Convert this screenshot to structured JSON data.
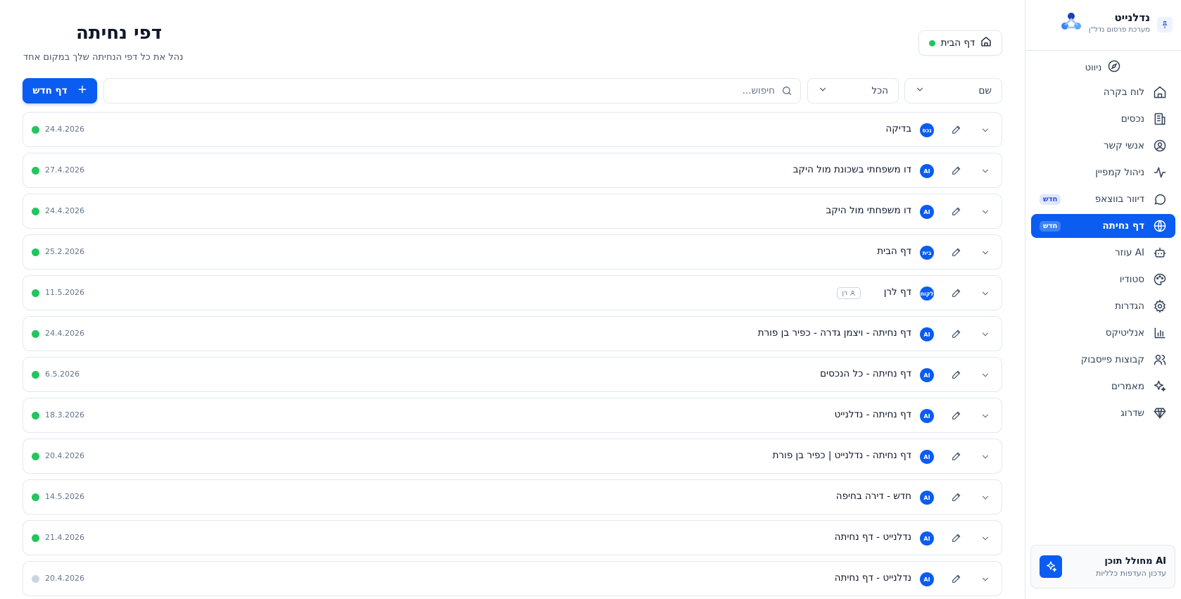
{
  "sidebar": {
    "brand_name": "נדלנייט",
    "brand_sub": "מערכת פרסום נדל\"ן",
    "nav_title": "ניווט",
    "items": [
      {
        "label": "לוח בקרה",
        "icon": "home-icon"
      },
      {
        "label": "נכסים",
        "icon": "building-icon"
      },
      {
        "label": "אנשי קשר",
        "icon": "user-circle-icon"
      },
      {
        "label": "ניהול קמפיין",
        "icon": "activity-icon"
      },
      {
        "label": "דיוור בווצאפ",
        "icon": "chat-icon",
        "badge": "חדש"
      },
      {
        "label": "דף נחיתה",
        "icon": "globe-icon",
        "badge": "חדש",
        "active": true
      },
      {
        "label": "עוזר AI",
        "icon": "bot-icon"
      },
      {
        "label": "סטודיו",
        "icon": "palette-icon"
      },
      {
        "label": "הגדרות",
        "icon": "gear-icon"
      },
      {
        "label": "אנליטיקס",
        "icon": "bar-chart-icon"
      },
      {
        "label": "קבוצות פייסבוק",
        "icon": "users-icon"
      },
      {
        "label": "מאמרים",
        "icon": "sparkles-icon"
      },
      {
        "label": "שדרוג",
        "icon": "gem-icon"
      }
    ],
    "ai_card": {
      "title": "מחולל תוכן AI",
      "subtitle": "עדכון העדפות כלליות"
    }
  },
  "header": {
    "title": "דפי נחיתה",
    "subtitle": "נהל את כל דפי הנחיתה שלך במקום אחד",
    "home_button": "דף הבית"
  },
  "toolbar": {
    "new_button": "דף חדש",
    "search_placeholder": "חיפוש...",
    "filter_value": "הכל",
    "sort_value": "שם"
  },
  "pages": [
    {
      "name": "בדיקה",
      "tag": "נכס",
      "date": "24.4.2026",
      "active": true
    },
    {
      "name": "דו משפחתי בשכונת מול היקב",
      "tag": "AI",
      "date": "27.4.2026",
      "active": true
    },
    {
      "name": "דו משפחתי מול היקב",
      "tag": "AI",
      "date": "24.4.2026",
      "active": true
    },
    {
      "name": "דף הבית",
      "tag": "בית",
      "date": "25.2.2026",
      "active": true
    },
    {
      "name": "דף לרן",
      "tag": "לקוח",
      "date": "11.5.2026",
      "active": true,
      "owner": "רן"
    },
    {
      "name": "דף נחיתה - ויצמן גדרה - כפיר בן פורת",
      "tag": "AI",
      "date": "24.4.2026",
      "active": true
    },
    {
      "name": "דף נחיתה - כל הנכסים",
      "tag": "AI",
      "date": "6.5.2026",
      "active": true
    },
    {
      "name": "דף נחיתה - נדלנייט",
      "tag": "AI",
      "date": "18.3.2026",
      "active": true
    },
    {
      "name": "דף נחיתה - נדלנייט | כפיר בן פורת",
      "tag": "AI",
      "date": "20.4.2026",
      "active": true
    },
    {
      "name": "חדש - דירה בחיפה",
      "tag": "AI",
      "date": "14.5.2026",
      "active": true
    },
    {
      "name": "נדלנייט - דף נחיתה",
      "tag": "AI",
      "date": "21.4.2026",
      "active": true
    },
    {
      "name": "נדלנייט - דף נחיתה",
      "tag": "AI",
      "date": "20.4.2026",
      "active": false
    }
  ],
  "colors": {
    "accent": "#0b5cf0",
    "status_active": "#22c55e",
    "status_inactive": "#cbd5e1"
  }
}
